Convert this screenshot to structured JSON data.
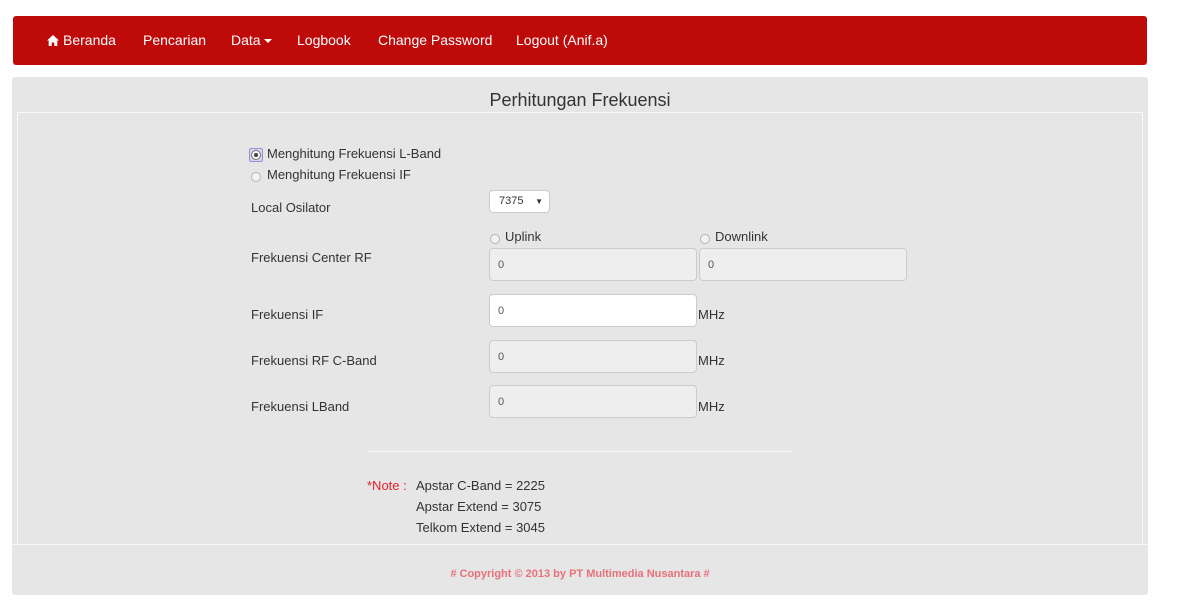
{
  "nav": {
    "home": "Beranda",
    "search": "Pencarian",
    "data": "Data",
    "logbook": "Logbook",
    "change_password": "Change Password",
    "logout": "Logout (Anif.a)"
  },
  "title": "Perhitungan Frekuensi",
  "mode_options": [
    {
      "label": "Menghitung Frekuensi L-Band",
      "checked": true
    },
    {
      "label": "Menghitung Frekuensi IF",
      "checked": false
    }
  ],
  "form": {
    "local_osc_label": "Local Osilator",
    "local_osc_value": "7375",
    "center_rf_label": "Frekuensi Center RF",
    "uplink_label": "Uplink",
    "downlink_label": "Downlink",
    "uplink_value": "0",
    "downlink_value": "0",
    "if_label": "Frekuensi IF",
    "if_value": "0",
    "rf_cband_label": "Frekuensi RF C-Band",
    "rf_cband_value": "0",
    "lband_label": "Frekuensi LBand",
    "lband_value": "0",
    "unit": "MHz"
  },
  "note": {
    "prefix": "*Note :",
    "lines": [
      "Apstar C-Band = 2225",
      "Apstar Extend = 3075",
      "Telkom Extend = 3045"
    ]
  },
  "footer": "# Copyright © 2013 by PT Multimedia Nusantara #",
  "colors": {
    "navbar": "#bf0a0a",
    "panel": "#e6e6e6",
    "note": "#e8202a",
    "footer": "#e8707a"
  }
}
